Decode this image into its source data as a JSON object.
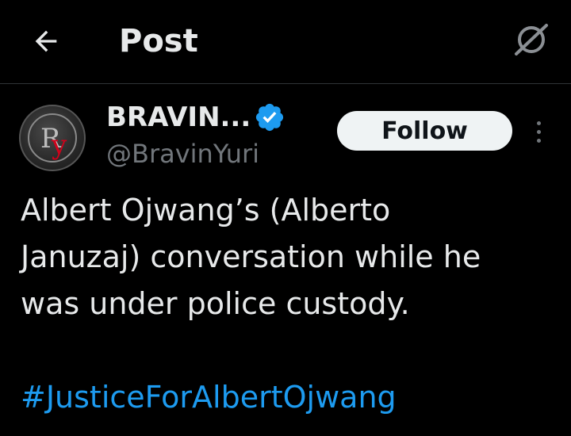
{
  "header": {
    "title": "Post",
    "back_icon": "arrow-left-icon",
    "grok_icon": "grok-icon"
  },
  "author": {
    "display_name": "BRAVIN...",
    "handle": "@BravinYuri",
    "verified": true,
    "avatar_logo_text": "RY",
    "avatar_logo_color": "#d0021b"
  },
  "actions": {
    "follow_label": "Follow",
    "more_icon": "more-vertical-icon"
  },
  "post": {
    "text_lines": [
      "Albert Ojwang’s (Alberto",
      "Januzaj) conversation while he",
      "was under police custody."
    ],
    "hashtag": "#JusticeForAlbertOjwang"
  },
  "colors": {
    "background": "#000000",
    "primary_text": "#e7e9ea",
    "secondary_text": "#71767b",
    "link": "#1d9bf0",
    "verified_badge": "#1d9bf0",
    "follow_bg": "#eff3f4",
    "divider": "#2f3336"
  }
}
